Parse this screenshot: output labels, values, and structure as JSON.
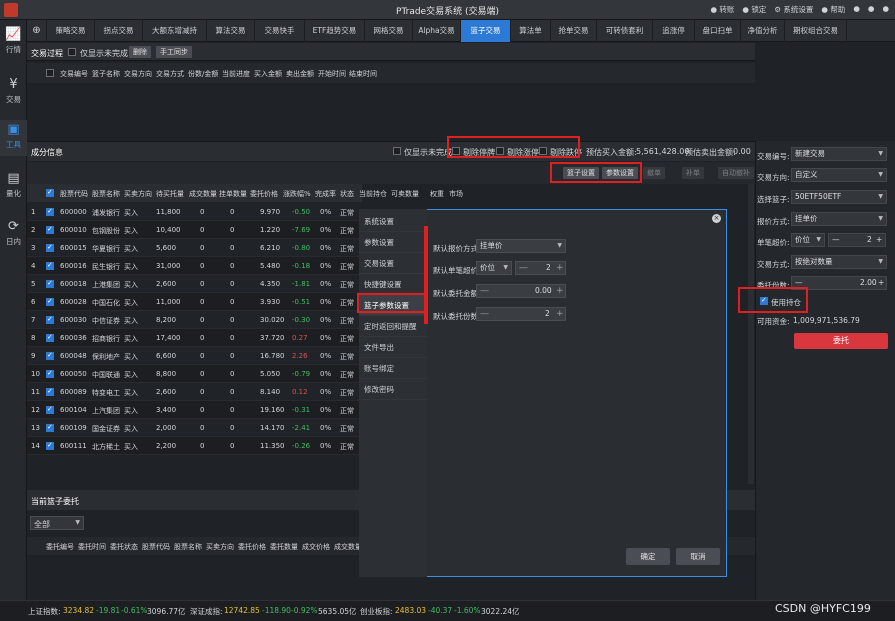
{
  "window": {
    "title": "PTrade交易系统 (交易端)",
    "tools": [
      "转账",
      "锁定",
      "系统设置",
      "帮助"
    ]
  },
  "sidebar": [
    {
      "label": "行情",
      "icon": "chart-icon"
    },
    {
      "label": "交易",
      "icon": "yen-icon"
    },
    {
      "label": "工具",
      "icon": "toolbox-icon",
      "active": true
    },
    {
      "label": "量化",
      "icon": "quant-icon"
    },
    {
      "label": "日内",
      "icon": "intraday-icon"
    }
  ],
  "tabs": [
    "策略交易",
    "拐点交易",
    "大额东增减持",
    "算法交易",
    "交易快手",
    "ETF趋势交易",
    "网格交易",
    "Alpha交易",
    "篮子交易",
    "算法单",
    "抢单交易",
    "可转债套利",
    "追涨停",
    "盘口扫单",
    "净值分析",
    "期权组合交易"
  ],
  "active_tab": "篮子交易",
  "trade_process": {
    "title": "交易过程",
    "only_unfinished": "仅显示未完成",
    "delete_btn": "删除",
    "sync_btn": "手工同步",
    "headers": [
      "交易编号",
      "篮子名称",
      "交易方向",
      "交易方式",
      "份数/金额",
      "当前进度",
      "买入金额",
      "卖出金额",
      "开始时间",
      "结束时间"
    ]
  },
  "components": {
    "title": "成分信息",
    "only_unfinished": "仅显示未完成",
    "remove_suspended": "剔除停牌",
    "remove_limit_up": "剔除涨停",
    "remove_limit_down": "剔除跌停",
    "est_buy_label": "预估买入金额:",
    "est_buy_value": "5,561,428.00",
    "est_sell_label": "预估卖出金额:",
    "est_sell_value": "0.00",
    "basket_settings_btn": "篮子设置",
    "param_settings_btn": "参数设置",
    "disabled_btns": [
      "撤单",
      "补单",
      "自动撤补"
    ],
    "headers": [
      "股票代码",
      "股票名称",
      "买卖方向",
      "待买托量",
      "成交数量",
      "挂单数量",
      "委托价格",
      "涨跌幅%",
      "完成率",
      "状态",
      "当前持仓",
      "可卖数量",
      "权重",
      "市场"
    ],
    "rows": [
      {
        "idx": "1",
        "code": "600000",
        "name": "浦发银行",
        "dir": "买入",
        "qty": "11,800",
        "filled": "0",
        "pending": "0",
        "price": "9.970",
        "chg": "-0.50",
        "rate": "0%",
        "status": "正常"
      },
      {
        "idx": "2",
        "code": "600010",
        "name": "包钢股份",
        "dir": "买入",
        "qty": "10,400",
        "filled": "0",
        "pending": "0",
        "price": "1.220",
        "chg": "-7.69",
        "rate": "0%",
        "status": "正常"
      },
      {
        "idx": "3",
        "code": "600015",
        "name": "华夏银行",
        "dir": "买入",
        "qty": "5,600",
        "filled": "0",
        "pending": "0",
        "price": "6.210",
        "chg": "-0.80",
        "rate": "0%",
        "status": "正常"
      },
      {
        "idx": "4",
        "code": "600016",
        "name": "民生银行",
        "dir": "买入",
        "qty": "31,000",
        "filled": "0",
        "pending": "0",
        "price": "5.480",
        "chg": "-0.18",
        "rate": "0%",
        "status": "正常"
      },
      {
        "idx": "5",
        "code": "600018",
        "name": "上港集团",
        "dir": "买入",
        "qty": "2,600",
        "filled": "0",
        "pending": "0",
        "price": "4.350",
        "chg": "-1.81",
        "rate": "0%",
        "status": "正常"
      },
      {
        "idx": "6",
        "code": "600028",
        "name": "中国石化",
        "dir": "买入",
        "qty": "11,000",
        "filled": "0",
        "pending": "0",
        "price": "3.930",
        "chg": "-0.51",
        "rate": "0%",
        "status": "正常"
      },
      {
        "idx": "7",
        "code": "600030",
        "name": "中信证券",
        "dir": "买入",
        "qty": "8,200",
        "filled": "0",
        "pending": "0",
        "price": "30.020",
        "chg": "-0.30",
        "rate": "0%",
        "status": "正常"
      },
      {
        "idx": "8",
        "code": "600036",
        "name": "招商银行",
        "dir": "买入",
        "qty": "17,400",
        "filled": "0",
        "pending": "0",
        "price": "37.720",
        "chg": "0.27",
        "rate": "0%",
        "status": "正常"
      },
      {
        "idx": "9",
        "code": "600048",
        "name": "保利地产",
        "dir": "买入",
        "qty": "6,600",
        "filled": "0",
        "pending": "0",
        "price": "16.780",
        "chg": "2.26",
        "rate": "0%",
        "status": "正常"
      },
      {
        "idx": "10",
        "code": "600050",
        "name": "中国联通",
        "dir": "买入",
        "qty": "8,800",
        "filled": "0",
        "pending": "0",
        "price": "5.050",
        "chg": "-0.79",
        "rate": "0%",
        "status": "正常"
      },
      {
        "idx": "11",
        "code": "600089",
        "name": "特变电工",
        "dir": "买入",
        "qty": "2,600",
        "filled": "0",
        "pending": "0",
        "price": "8.140",
        "chg": "0.12",
        "rate": "0%",
        "status": "正常"
      },
      {
        "idx": "12",
        "code": "600104",
        "name": "上汽集团",
        "dir": "买入",
        "qty": "3,400",
        "filled": "0",
        "pending": "0",
        "price": "19.160",
        "chg": "-0.31",
        "rate": "0%",
        "status": "正常"
      },
      {
        "idx": "13",
        "code": "600109",
        "name": "国金证券",
        "dir": "买入",
        "qty": "2,000",
        "filled": "0",
        "pending": "0",
        "price": "14.170",
        "chg": "-2.41",
        "rate": "0%",
        "status": "正常"
      },
      {
        "idx": "14",
        "code": "600111",
        "name": "北方稀土",
        "dir": "买入",
        "qty": "2,200",
        "filled": "0",
        "pending": "0",
        "price": "11.350",
        "chg": "-0.26",
        "rate": "0%",
        "status": "正常"
      }
    ]
  },
  "orders": {
    "title": "当前篮子委托",
    "filter": "全部",
    "headers": [
      "委托编号",
      "委托时间",
      "委托状态",
      "股票代码",
      "股票名称",
      "买卖方向",
      "委托价格",
      "委托数量",
      "成交价格",
      "成交数量"
    ]
  },
  "right_panel": {
    "trade_no_label": "交易编号:",
    "trade_no": "新建交易",
    "dir_label": "交易方向:",
    "dir": "自定义",
    "basket_label": "选择篮子:",
    "basket": "50ETF50ETF",
    "price_mode_label": "报价方式:",
    "price_mode": "挂单价",
    "tick_label": "单笔超价:",
    "tick_unit": "价位",
    "tick_value": "2",
    "trade_mode_label": "交易方式:",
    "trade_mode": "按绝对数量",
    "units_label": "委托份数:",
    "units_value": "2.00",
    "use_position": "使用持仓",
    "available_label": "可用资金:",
    "available": "1,009,971,536.79",
    "entrust_btn": "委托"
  },
  "dialog": {
    "menu": [
      "系统设置",
      "参数设置",
      "交易设置",
      "快捷键设置",
      "篮子参数设置",
      "定时返回和提醒",
      "文件导出",
      "账号绑定",
      "修改密码"
    ],
    "selected": "篮子参数设置",
    "fields": {
      "price_mode_label": "默认报价方式",
      "price_mode": "挂单价",
      "tick_label": "默认单笔超价",
      "tick_unit": "价位",
      "tick_value": "2",
      "amount_label": "默认委托金额",
      "amount_value": "0.00",
      "units_label": "默认委托份数",
      "units_value": "2"
    },
    "ok": "确定",
    "cancel": "取消"
  },
  "status_bar": {
    "sh_label": "上证指数:",
    "sh_value": "3234.82",
    "sh_chg": "-19.81",
    "sh_pct": "-0.61%",
    "sh_amt": "3096.77亿",
    "sz_label": "深证成指:",
    "sz_value": "12742.85",
    "sz_chg": "-118.90",
    "sz_pct": "-0.92%",
    "sz_amt": "5635.05亿",
    "cy_label": "创业板指:",
    "cy_value": "2483.03",
    "cy_chg": "-40.37",
    "cy_pct": "-1.60%",
    "cy_amt": "3022.24亿",
    "watermark": "CSDN @HYFC199"
  }
}
